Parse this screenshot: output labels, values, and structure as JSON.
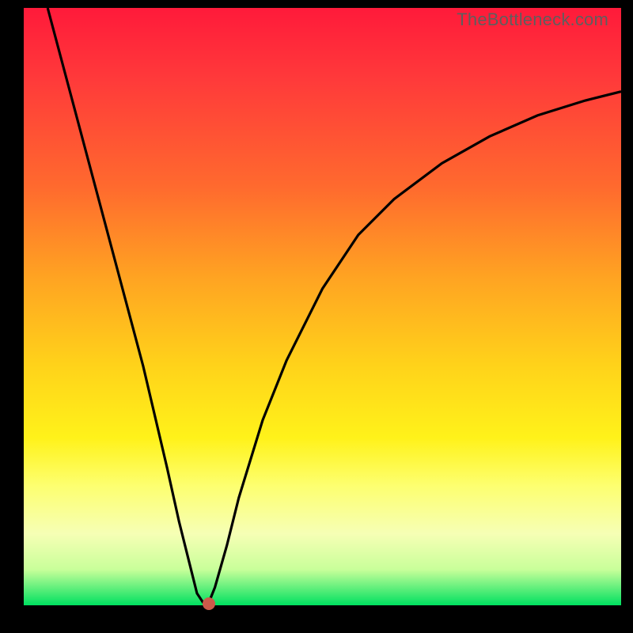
{
  "watermark": "TheBottleneck.com",
  "chart_data": {
    "type": "line",
    "title": "",
    "xlabel": "",
    "ylabel": "",
    "xlim": [
      0,
      100
    ],
    "ylim": [
      0,
      100
    ],
    "grid": false,
    "series": [
      {
        "name": "curve",
        "x": [
          4,
          8,
          12,
          16,
          20,
          24,
          26,
          28,
          29,
          30,
          30.5,
          31,
          32,
          34,
          36,
          40,
          44,
          50,
          56,
          62,
          70,
          78,
          86,
          94,
          100
        ],
        "y": [
          100,
          85,
          70,
          55,
          40,
          23,
          14,
          6,
          2,
          0.5,
          0.2,
          0.5,
          3,
          10,
          18,
          31,
          41,
          53,
          62,
          68,
          74,
          78.5,
          82,
          84.5,
          86
        ]
      }
    ],
    "marker": {
      "x": 31,
      "y": 0.2
    },
    "colors": {
      "curve": "#000000",
      "marker": "#cc5a4a",
      "gradient_top": "#ff1a3a",
      "gradient_bottom": "#00e060",
      "frame": "#000000"
    }
  }
}
